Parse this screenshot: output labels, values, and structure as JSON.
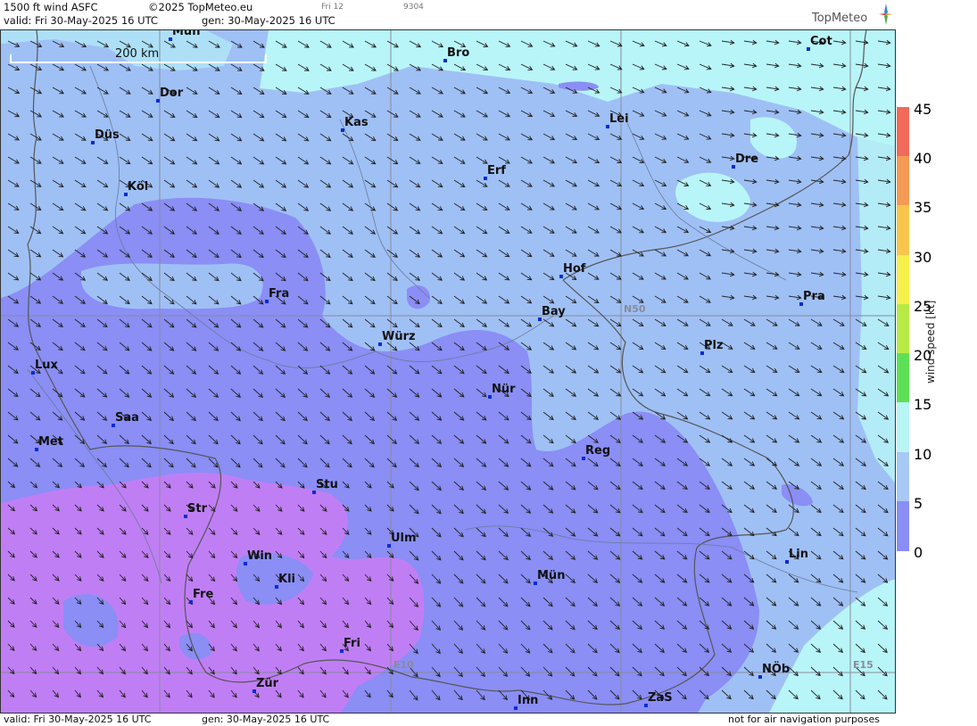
{
  "header": {
    "product": "1500 ft wind ASFC",
    "copyright": "©2025 TopMeteo.eu",
    "tag1": "Fri 12",
    "tag2": "9304",
    "valid": "valid:  Fri  30-May-2025  16 UTC",
    "gen": "gen:  30-May-2025 16 UTC",
    "logo_text": "TopMeteo"
  },
  "footer": {
    "valid": "valid:  Fri  30-May-2025  16 UTC",
    "gen": "gen:  30-May-2025 16 UTC",
    "disclaimer": "not for air navigation purposes"
  },
  "scale_bar": {
    "label": "200 km"
  },
  "grid_labels": {
    "lat": "N50",
    "lon1": "E10",
    "lon2": "E15"
  },
  "cities": [
    {
      "name": "Mün",
      "id": "mun-top"
    },
    {
      "name": "Bro",
      "id": "bro"
    },
    {
      "name": "Cot",
      "id": "cot"
    },
    {
      "name": "Dor",
      "id": "dor"
    },
    {
      "name": "Kas",
      "id": "kas"
    },
    {
      "name": "Lei",
      "id": "lei"
    },
    {
      "name": "Düs",
      "id": "dus"
    },
    {
      "name": "Erf",
      "id": "erf"
    },
    {
      "name": "Dre",
      "id": "dre"
    },
    {
      "name": "Köl",
      "id": "kol"
    },
    {
      "name": "Hof",
      "id": "hof"
    },
    {
      "name": "Fra",
      "id": "fra"
    },
    {
      "name": "Pra",
      "id": "pra"
    },
    {
      "name": "Bay",
      "id": "bay"
    },
    {
      "name": "Würz",
      "id": "wur"
    },
    {
      "name": "Plz",
      "id": "plz"
    },
    {
      "name": "Lux",
      "id": "lux"
    },
    {
      "name": "Nür",
      "id": "nur"
    },
    {
      "name": "Saa",
      "id": "saa"
    },
    {
      "name": "Met",
      "id": "met"
    },
    {
      "name": "Reg",
      "id": "reg"
    },
    {
      "name": "Stu",
      "id": "stu"
    },
    {
      "name": "Str",
      "id": "str"
    },
    {
      "name": "Ulm",
      "id": "ulm"
    },
    {
      "name": "Win",
      "id": "win"
    },
    {
      "name": "Lin",
      "id": "lin"
    },
    {
      "name": "Kli",
      "id": "kli"
    },
    {
      "name": "Mün",
      "id": "mun"
    },
    {
      "name": "Fre",
      "id": "fre"
    },
    {
      "name": "Fri",
      "id": "fri"
    },
    {
      "name": "NÖb",
      "id": "nob"
    },
    {
      "name": "Zür",
      "id": "zur"
    },
    {
      "name": "ZaS",
      "id": "zas"
    },
    {
      "name": "Inn",
      "id": "inn"
    }
  ],
  "legend": {
    "label": "wind speed [kt]",
    "ticks": [
      "45",
      "40",
      "35",
      "30",
      "25",
      "20",
      "15",
      "10",
      "5",
      "0"
    ],
    "colors": [
      "#f26a5a",
      "#f59a55",
      "#f8c64c",
      "#f5f04a",
      "#b8ea45",
      "#5ee056",
      "#b8f5f5",
      "#a8c8f5",
      "#8a8ef5",
      "#c07ef5"
    ]
  },
  "map_colors": {
    "calm": "#c07ef5",
    "light": "#8a8ef5",
    "moderate": "#9fc0f5",
    "fresh": "#b8f5f8"
  }
}
